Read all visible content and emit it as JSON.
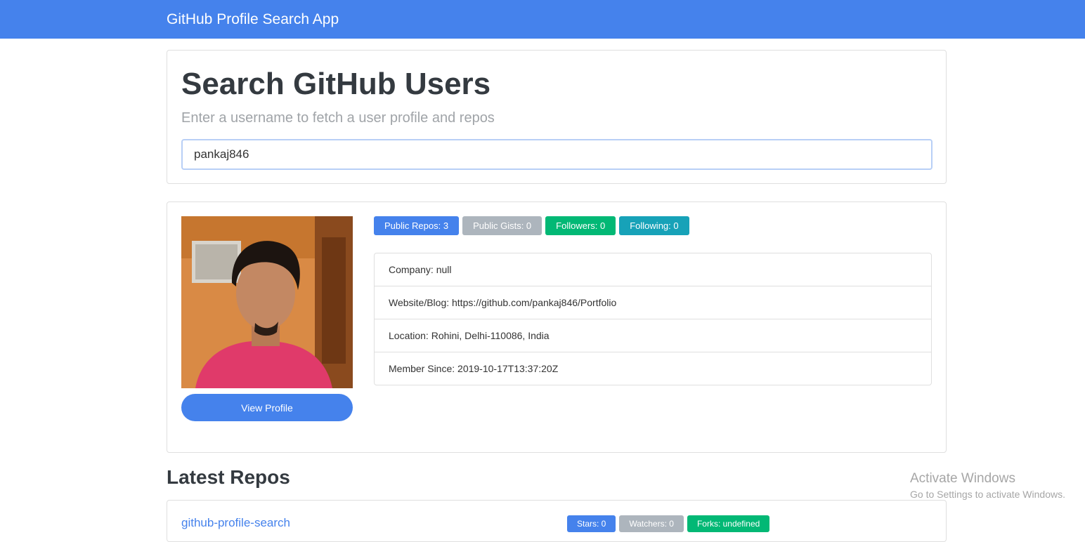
{
  "navbar": {
    "brand": "GitHub Profile Search App"
  },
  "search": {
    "heading": "Search GitHub Users",
    "lead": "Enter a username to fetch a user profile and repos",
    "value": "pankaj846"
  },
  "profile": {
    "view_button": "View Profile",
    "badges": {
      "repos": "Public Repos: 3",
      "gists": "Public Gists: 0",
      "followers": "Followers: 0",
      "following": "Following: 0"
    },
    "details": {
      "company": "Company: null",
      "website": "Website/Blog: https://github.com/pankaj846/Portfolio",
      "location": "Location: Rohini, Delhi-110086, India",
      "member_since": "Member Since: 2019-10-17T13:37:20Z"
    }
  },
  "repos": {
    "heading": "Latest Repos",
    "items": [
      {
        "name": "github-profile-search",
        "stars": "Stars: 0",
        "watchers": "Watchers: 0",
        "forks": "Forks: undefined"
      }
    ]
  },
  "watermark": {
    "title": "Activate Windows",
    "subtitle": "Go to Settings to activate Windows."
  },
  "colors": {
    "primary": "#4582ec",
    "secondary": "#adb5bd",
    "success": "#02b875",
    "info": "#17a2b8"
  }
}
